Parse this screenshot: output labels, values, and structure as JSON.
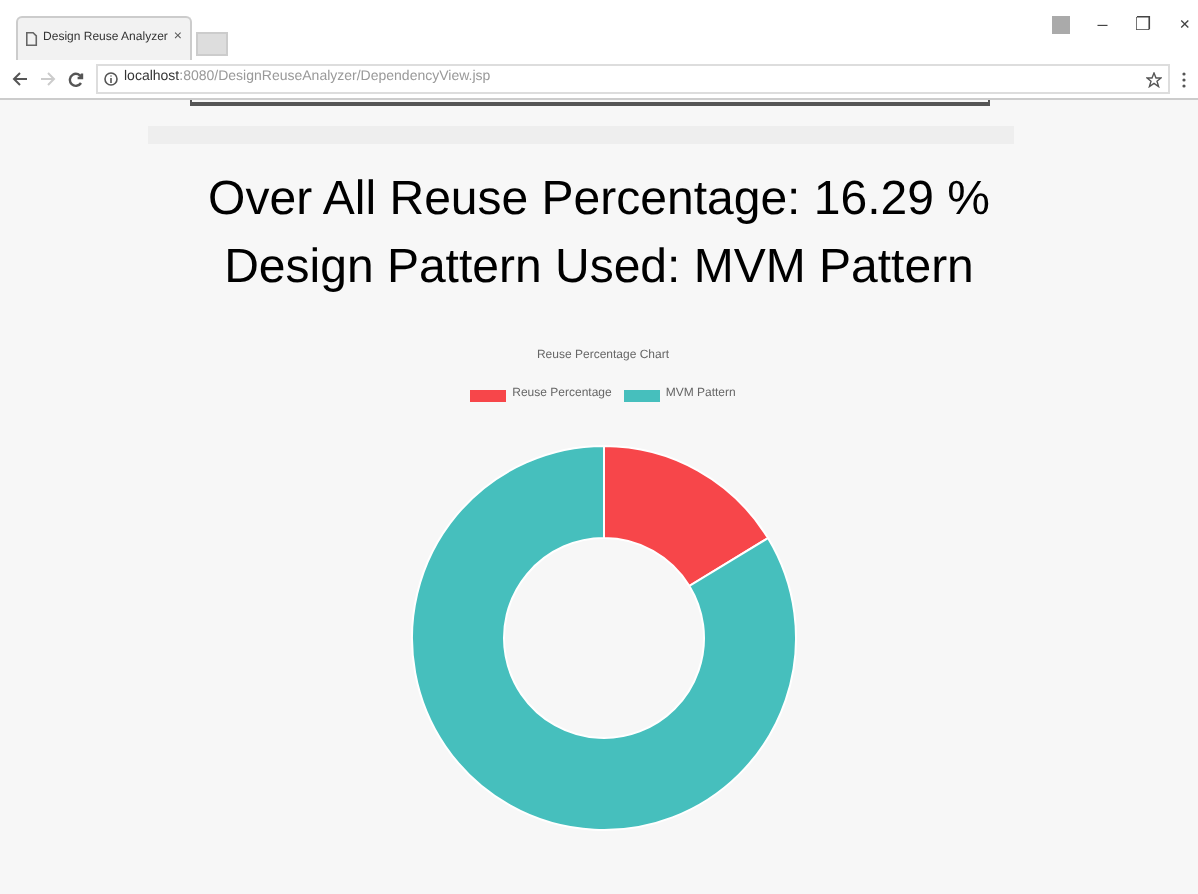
{
  "browser": {
    "tab_title": "Design Reuse Analyzer",
    "tab_close": "×",
    "url_host": "localhost",
    "url_path": ":8080/DesignReuseAnalyzer/DependencyView.jsp",
    "window_controls": [
      "–",
      "❐",
      "×"
    ]
  },
  "headings": [
    "Over All Reuse Percentage: 16.29 %",
    "Design Pattern Used: MVM Pattern"
  ],
  "chart": {
    "chart_data": {
      "type": "donut",
      "title": "Reuse Percentage Chart",
      "categories": [
        "Reuse Percentage",
        "MVM Pattern"
      ],
      "legend": "top",
      "values": [
        16.29,
        83.71
      ],
      "colors": [
        "#f7464a",
        "#46bfbd"
      ]
    }
  }
}
